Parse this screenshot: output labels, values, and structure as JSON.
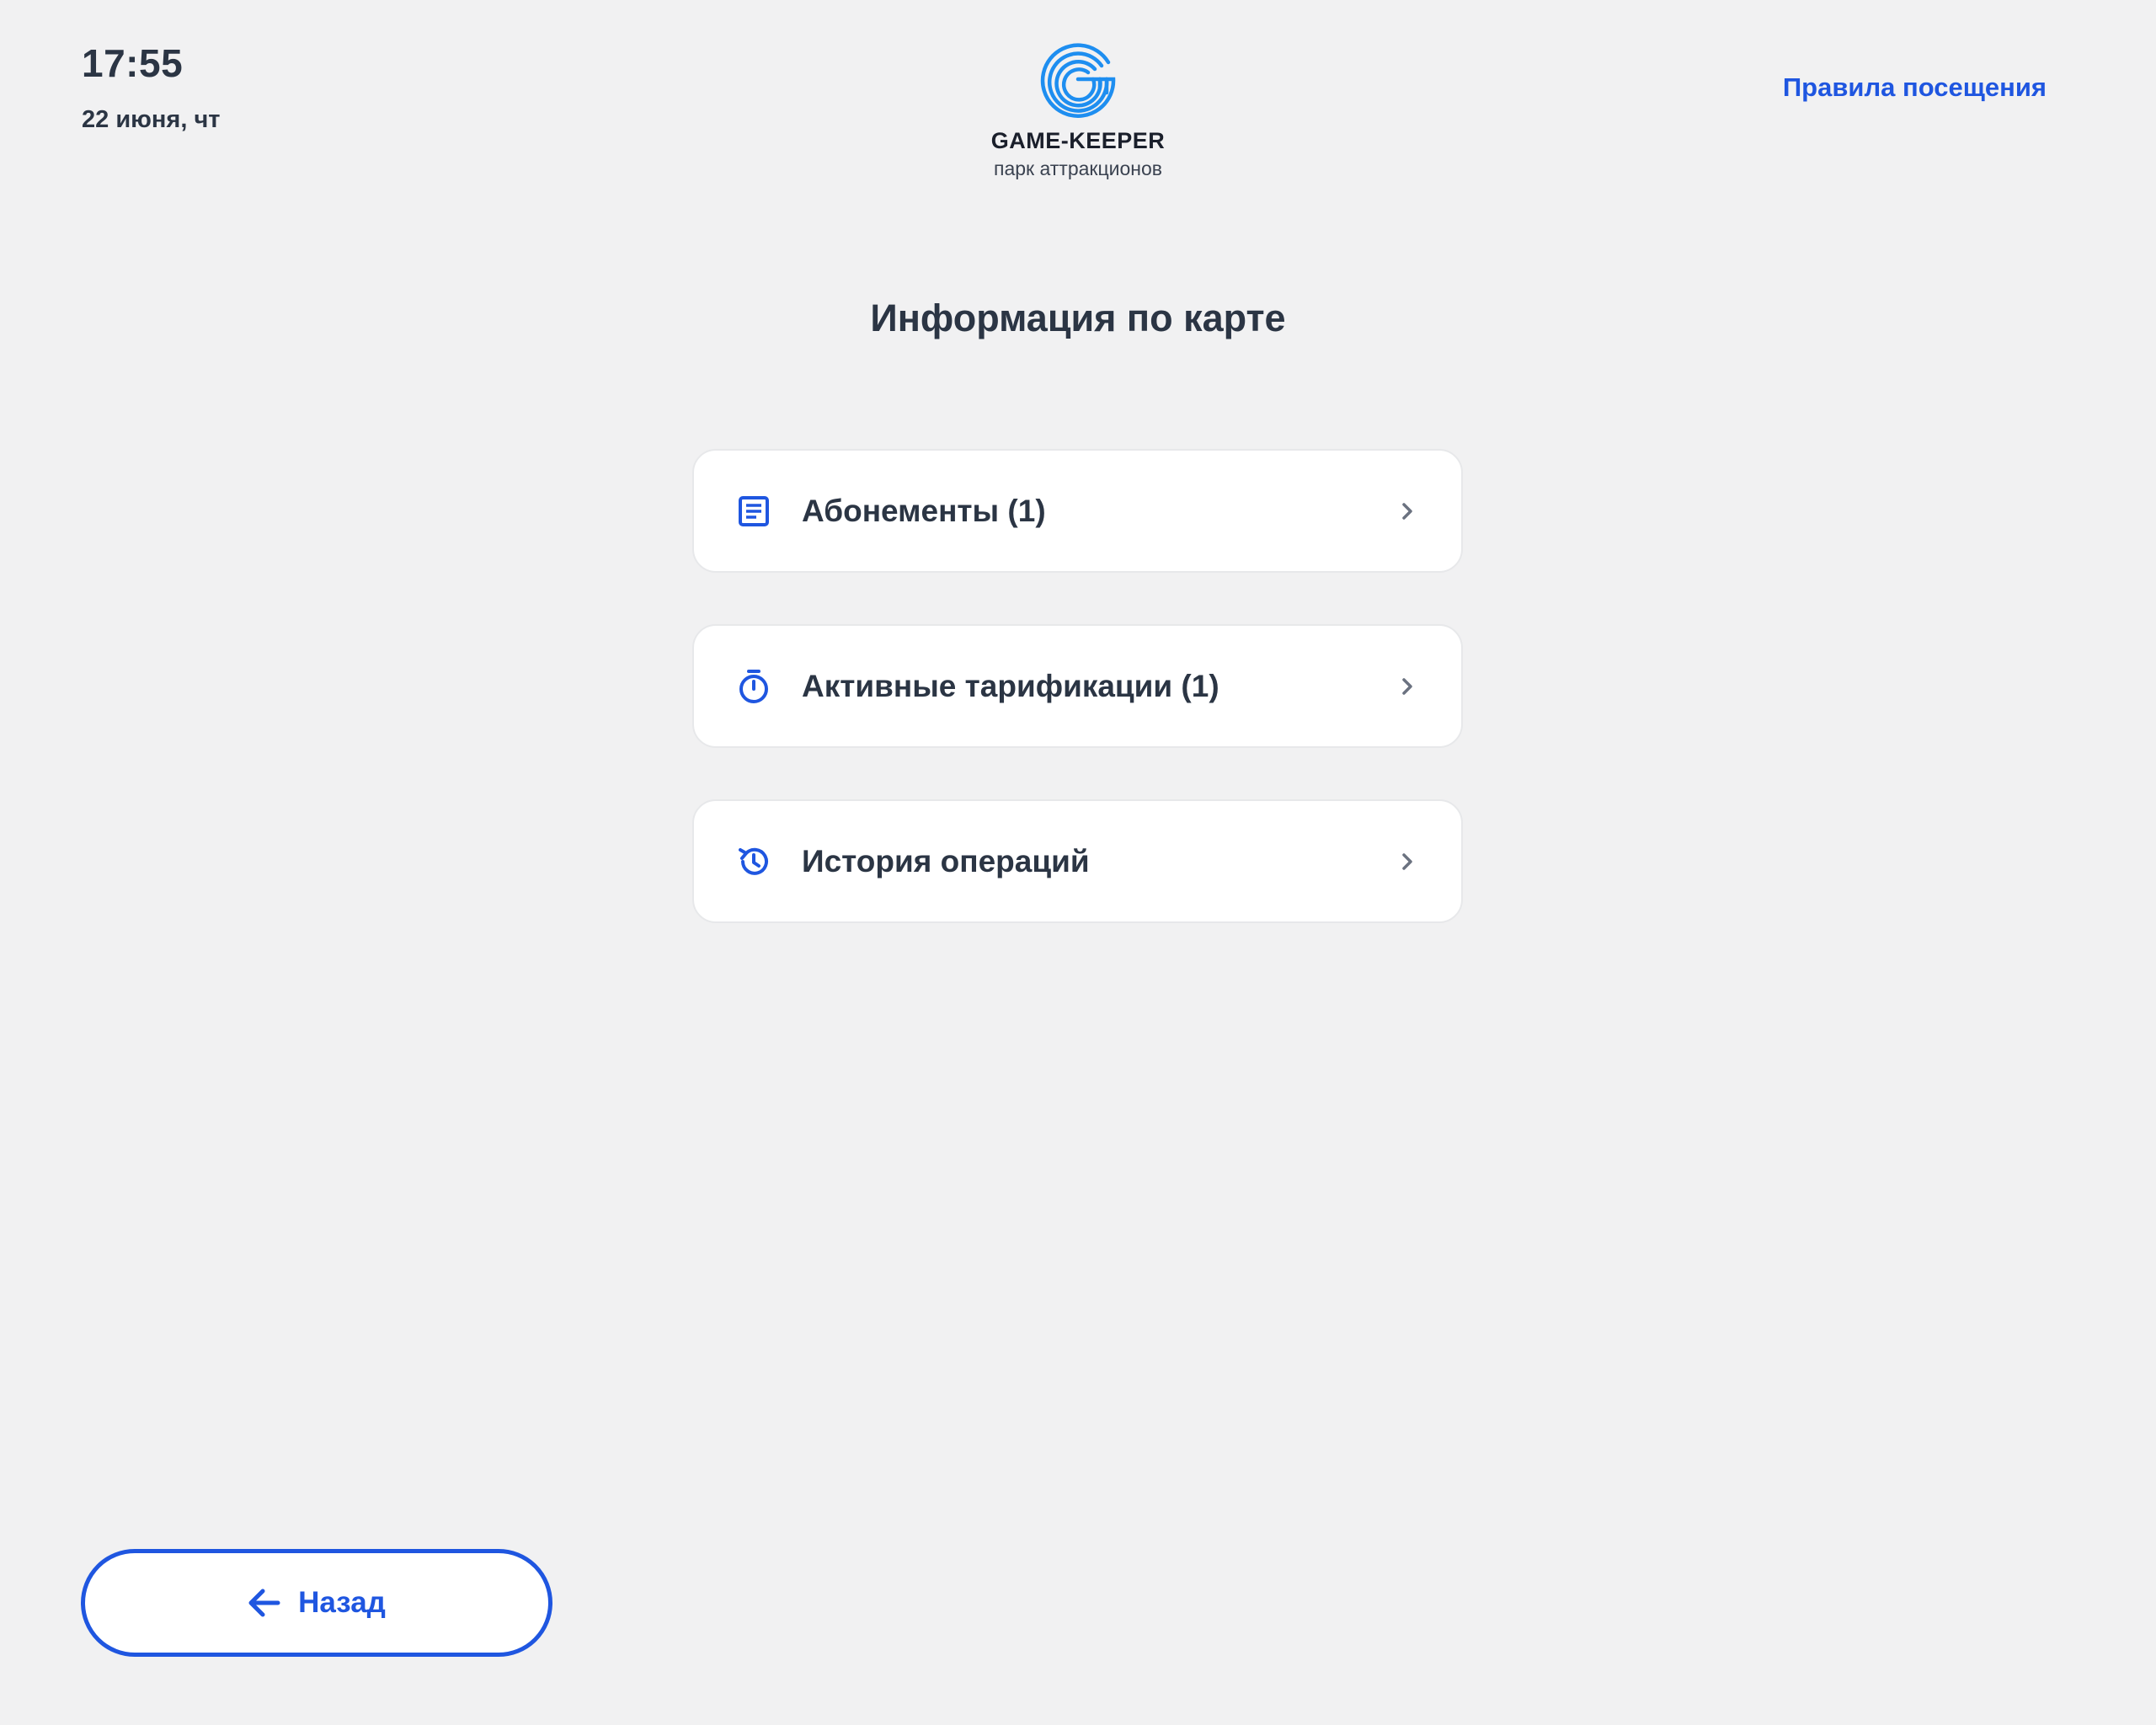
{
  "header": {
    "time": "17:55",
    "date": "22 июня, чт",
    "rules_link": "Правила посещения"
  },
  "logo": {
    "icon": "game-keeper-logo-icon",
    "name": "GAME-KEEPER",
    "subtitle": "парк аттракционов"
  },
  "main": {
    "title": "Информация по карте",
    "items": [
      {
        "label": "Абонементы (1)",
        "icon": "document-list-icon"
      },
      {
        "label": "Активные тарификации (1)",
        "icon": "stopwatch-icon"
      },
      {
        "label": "История операций",
        "icon": "history-icon"
      }
    ]
  },
  "footer": {
    "back_label": "Назад"
  },
  "colors": {
    "accent": "#1f56e0",
    "background": "#f1f1f2",
    "text": "#2b3544",
    "logo_blue": "#1e8ef0"
  }
}
